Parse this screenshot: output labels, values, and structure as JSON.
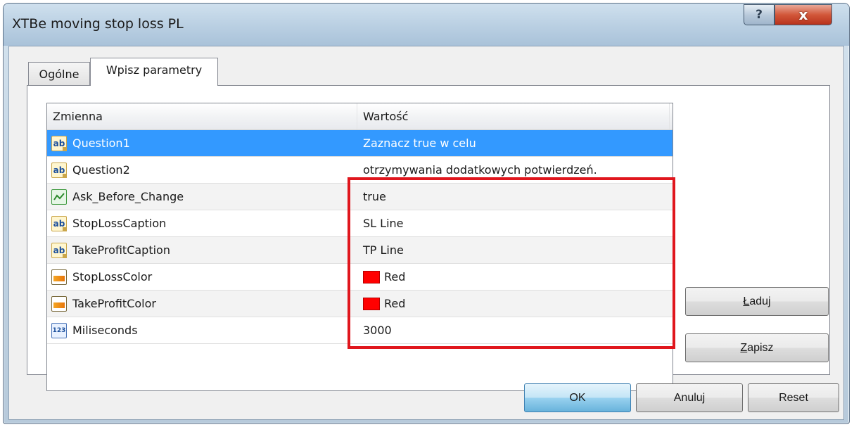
{
  "window": {
    "title": "XTBe moving stop loss PL",
    "help_label": "?",
    "close_label": "x"
  },
  "tabs": [
    {
      "label": "Ogólne"
    },
    {
      "label": "Wpisz parametry"
    }
  ],
  "grid": {
    "columns": [
      "Zmienna",
      "Wartość"
    ],
    "rows": [
      {
        "icon": "text-ab-icon",
        "icon_text": "ab",
        "name": "Question1",
        "value": "Zaznacz true w celu"
      },
      {
        "icon": "text-ab-icon",
        "icon_text": "ab",
        "name": "Question2",
        "value": "otrzymywania dodatkowych potwierdzeń."
      },
      {
        "icon": "bool-icon",
        "icon_text": "",
        "name": "Ask_Before_Change",
        "value": "true"
      },
      {
        "icon": "text-ab-icon",
        "icon_text": "ab",
        "name": "StopLossCaption",
        "value": "SL Line"
      },
      {
        "icon": "text-ab-icon",
        "icon_text": "ab",
        "name": "TakeProfitCaption",
        "value": "TP Line"
      },
      {
        "icon": "color-icon",
        "icon_text": "",
        "name": "StopLossColor",
        "value": "Red",
        "swatch": "#ff0000"
      },
      {
        "icon": "color-icon",
        "icon_text": "",
        "name": "TakeProfitColor",
        "value": "Red",
        "swatch": "#ff0000"
      },
      {
        "icon": "number-icon",
        "icon_text": "123",
        "name": "Miliseconds",
        "value": "3000"
      }
    ]
  },
  "buttons": {
    "load_first": "Ł",
    "load_rest": "aduj",
    "save_first": "Z",
    "save_rest": "apisz",
    "ok": "OK",
    "cancel": "Anuluj",
    "reset": "Reset"
  },
  "colors": {
    "selection": "#3399ff",
    "highlight_border": "#e0161d",
    "swatch_red": "#ff0000"
  }
}
